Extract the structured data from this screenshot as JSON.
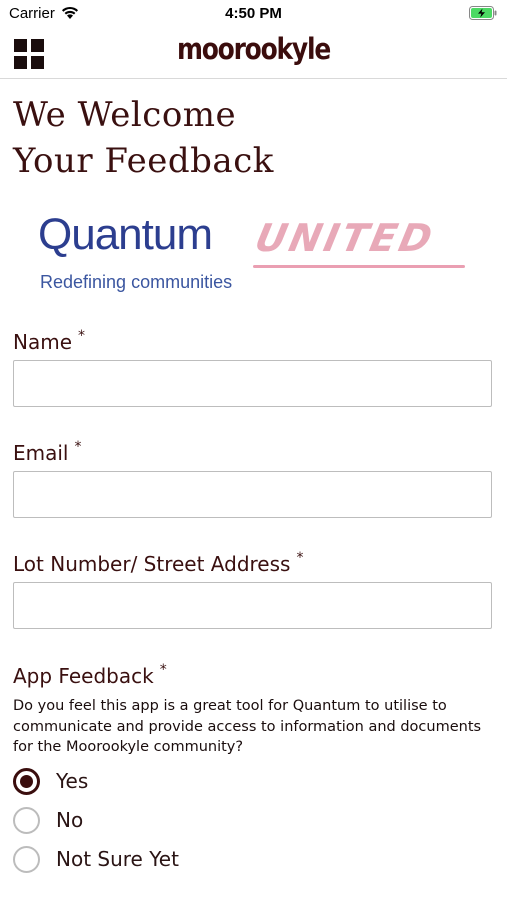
{
  "status_bar": {
    "carrier": "Carrier",
    "time": "4:50 PM",
    "wifi_icon": "wifi-icon",
    "battery_icon": "battery-charging-icon"
  },
  "nav": {
    "menu_icon": "grid-menu-icon",
    "title": "moorookyle"
  },
  "page": {
    "title_line1": "We Welcome",
    "title_line2": "Your Feedback"
  },
  "logo": {
    "word": "Quantum",
    "united": "UNITED",
    "tagline": "Redefining communities"
  },
  "form": {
    "name": {
      "label": "Name",
      "required": "*",
      "value": "",
      "placeholder": ""
    },
    "email": {
      "label": "Email",
      "required": "*",
      "value": "",
      "placeholder": ""
    },
    "address": {
      "label": "Lot Number/ Street Address",
      "required": "*",
      "value": "",
      "placeholder": ""
    },
    "feedback": {
      "label": "App Feedback",
      "required": "*",
      "question": "Do you feel this app is a great tool for Quantum to utilise to communicate and provide access to information and documents for the Moorookyle community?",
      "options": [
        "Yes",
        "No",
        "Not Sure Yet"
      ],
      "selected": "Yes"
    }
  },
  "colors": {
    "accent": "#3a0d0d",
    "logo_blue": "#2c3e8f",
    "logo_pink": "#e8a9b8"
  }
}
